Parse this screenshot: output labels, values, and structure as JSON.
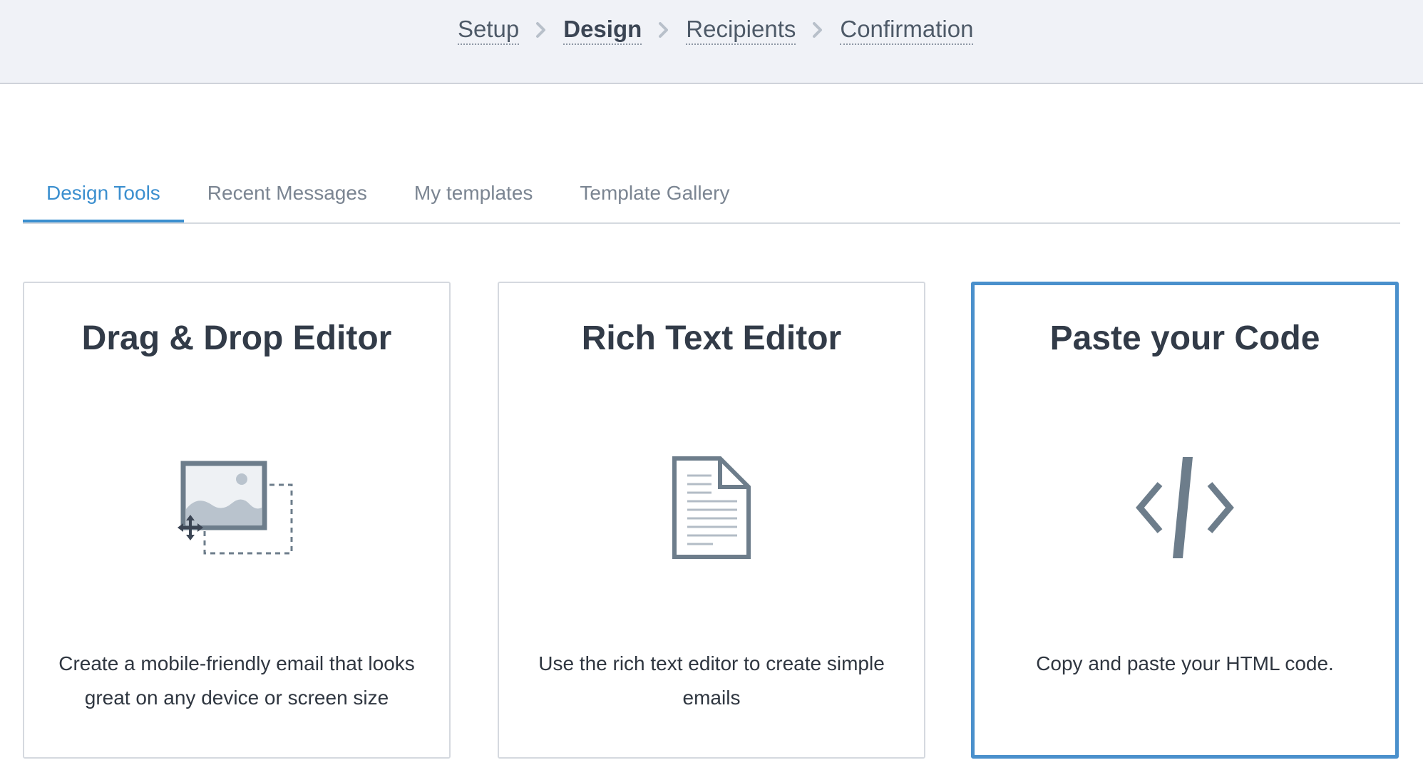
{
  "steps": {
    "items": [
      {
        "label": "Setup"
      },
      {
        "label": "Design"
      },
      {
        "label": "Recipients"
      },
      {
        "label": "Confirmation"
      }
    ],
    "active": "Design"
  },
  "tabs": {
    "items": [
      {
        "label": "Design Tools"
      },
      {
        "label": "Recent Messages"
      },
      {
        "label": "My templates"
      },
      {
        "label": "Template Gallery"
      }
    ],
    "active": "Design Tools"
  },
  "cards": [
    {
      "title": "Drag & Drop Editor",
      "icon": "drag-drop-image-icon",
      "description": "Create a mobile-friendly email that looks great on any device or screen size"
    },
    {
      "title": "Rich Text Editor",
      "icon": "document-icon",
      "description": "Use the rich text editor to create simple emails"
    },
    {
      "title": "Paste your Code",
      "icon": "code-icon",
      "description": "Copy and paste your HTML code.",
      "selected": true
    }
  ],
  "colors": {
    "accent": "#3b8fcf",
    "selected_border": "#4a90cc",
    "header_bg": "#f0f2f7",
    "title_text": "#323b48",
    "icon_gray": "#6d7d8b"
  }
}
